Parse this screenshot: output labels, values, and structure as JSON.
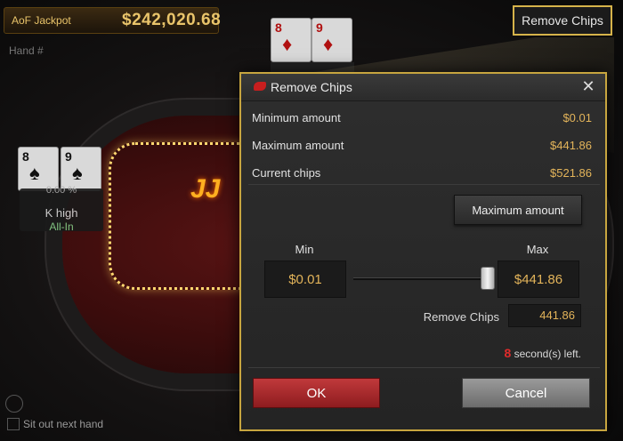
{
  "background": {
    "jackpot_label": "AoF Jackpot",
    "jackpot_amount": "$242,020.68",
    "hand_label": "Hand #",
    "top_cards": [
      {
        "rank": "8",
        "suit": "♦"
      },
      {
        "rank": "9",
        "suit": "♦"
      }
    ],
    "seat_cards": [
      {
        "rank": "8",
        "suit": "♠"
      },
      {
        "rank": "9",
        "suit": "♠"
      }
    ],
    "seat_equity": "0.00 %",
    "seat_hand": "K high",
    "seat_status": "All-In",
    "logo_text": "JJ",
    "sit_out_label": "Sit out next hand"
  },
  "top_button": {
    "label": "Remove Chips"
  },
  "dialog": {
    "title": "Remove Chips",
    "close_glyph": "✕",
    "rows": [
      {
        "label": "Minimum amount",
        "value": "$0.01"
      },
      {
        "label": "Maximum amount",
        "value": "$441.86"
      },
      {
        "label": "Current chips",
        "value": "$521.86"
      }
    ],
    "max_button": "Maximum amount",
    "min_label": "Min",
    "max_label": "Max",
    "min_value": "$0.01",
    "max_value": "$441.86",
    "slider_level": 1.0,
    "remove_label": "Remove Chips",
    "remove_value": "441.86",
    "timer_seconds": "8",
    "timer_text": "second(s) left.",
    "ok_label": "OK",
    "cancel_label": "Cancel"
  },
  "colors": {
    "accent_gold": "#c7a53f",
    "amount_gold": "#e3b45a",
    "ok_red": "#c0393b",
    "timer_red": "#e02b2b"
  }
}
